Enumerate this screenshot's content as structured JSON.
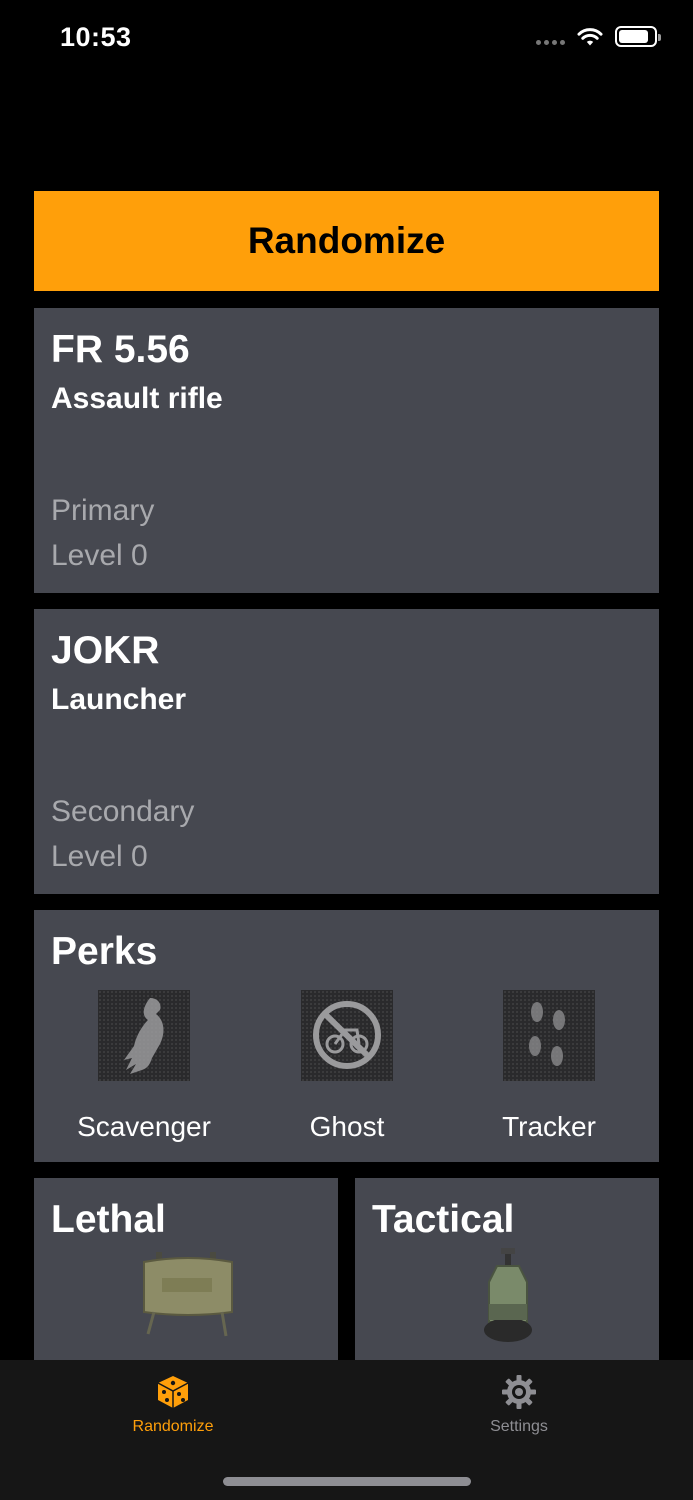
{
  "status_bar": {
    "time": "10:53",
    "battery_level": 0.85
  },
  "randomize_button": {
    "label": "Randomize",
    "color": "#ff9f0a"
  },
  "primary_weapon": {
    "name": "FR 5.56",
    "type": "Assault rifle",
    "slot": "Primary",
    "level": "Level 0"
  },
  "secondary_weapon": {
    "name": "JOKR",
    "type": "Launcher",
    "slot": "Secondary",
    "level": "Level 0"
  },
  "perks": {
    "title": "Perks",
    "items": [
      {
        "label": "Scavenger",
        "icon": "vulture-icon"
      },
      {
        "label": "Ghost",
        "icon": "no-drone-icon"
      },
      {
        "label": "Tracker",
        "icon": "footprints-icon"
      }
    ]
  },
  "lethal": {
    "title": "Lethal",
    "icon": "claymore-icon"
  },
  "tactical": {
    "title": "Tactical",
    "icon": "smoke-canister-icon"
  },
  "tab_bar": {
    "tabs": [
      {
        "label": "Randomize",
        "icon": "dice-icon",
        "active": true
      },
      {
        "label": "Settings",
        "icon": "gear-icon",
        "active": false
      }
    ],
    "active_color": "#ff9f0a"
  }
}
